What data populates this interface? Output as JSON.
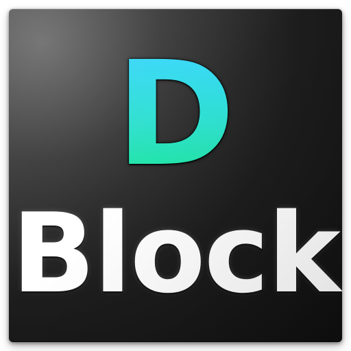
{
  "logo": {
    "initial": "D",
    "word": "Block"
  },
  "colors": {
    "tile_dark": "#111111",
    "tile_light": "#6b6b6b",
    "initial_top": "#38d6ff",
    "initial_bottom": "#1fe59c",
    "word": "#ffffff"
  }
}
